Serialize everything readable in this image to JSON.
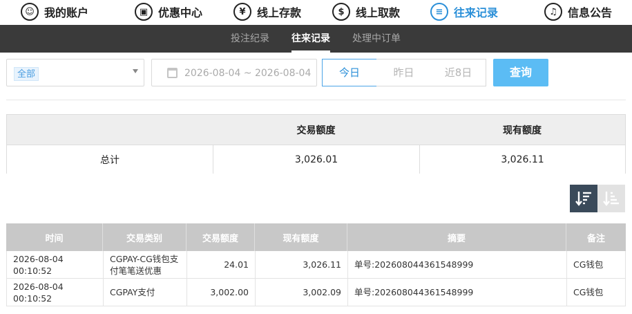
{
  "topnav": {
    "items": [
      {
        "label": "我的账户",
        "icon": "user-icon",
        "glyph": "☺"
      },
      {
        "label": "优惠中心",
        "icon": "gift-icon",
        "glyph": "▣"
      },
      {
        "label": "线上存款",
        "icon": "deposit-icon",
        "glyph": "¥"
      },
      {
        "label": "线上取款",
        "icon": "withdraw-icon",
        "glyph": "$"
      },
      {
        "label": "往来记录",
        "icon": "records-icon",
        "glyph": "≡"
      },
      {
        "label": "信息公告",
        "icon": "bell-icon",
        "glyph": "♫"
      }
    ],
    "active": "往来记录",
    "accent_color": "#2a8fd8"
  },
  "subnav": {
    "items": [
      {
        "label": "投注纪录"
      },
      {
        "label": "往来记录"
      },
      {
        "label": "处理中订单"
      }
    ],
    "active": "往来记录"
  },
  "filters": {
    "type_selected": "全部",
    "date_range": "2026-08-04 ~ 2026-08-04",
    "quick": {
      "today": "今日",
      "yesterday": "昨日",
      "last8": "近8日"
    },
    "quick_active": "今日",
    "query_label": "查询",
    "query_color": "#5bbcf4"
  },
  "summary": {
    "headers": {
      "amount": "交易额度",
      "balance": "现有额度"
    },
    "total_label": "总计",
    "total_amount": "3,026.01",
    "total_balance": "3,026.11"
  },
  "records": {
    "headers": {
      "time": "时间",
      "type": "交易类别",
      "amount": "交易额度",
      "balance": "现有额度",
      "summary": "摘要",
      "remark": "备注"
    },
    "rows": [
      {
        "time": "2026-08-04 00:10:52",
        "type": "CGPAY-CG钱包支付笔笔送优惠",
        "amount": "24.01",
        "balance": "3,026.11",
        "summary": "单号:202608044361548999",
        "remark": "CG钱包"
      },
      {
        "time": "2026-08-04 00:10:52",
        "type": "CGPAY支付",
        "amount": "3,002.00",
        "balance": "3,002.09",
        "summary": "单号:202608044361548999",
        "remark": "CG钱包"
      }
    ]
  }
}
